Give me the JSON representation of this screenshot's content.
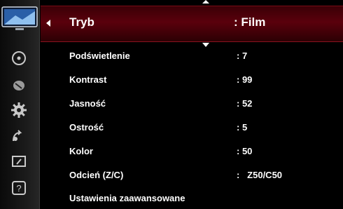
{
  "header": {
    "label": "Tryb",
    "value": ": Film"
  },
  "settings": [
    {
      "label": "Podświetlenie",
      "value": ": 7"
    },
    {
      "label": "Kontrast",
      "value": ": 99"
    },
    {
      "label": "Jasność",
      "value": ": 52"
    },
    {
      "label": "Ostrość",
      "value": ": 5"
    },
    {
      "label": "Kolor",
      "value": ": 50"
    },
    {
      "label": "Odcień (Z/C)",
      "value": ":   Z50/C50"
    },
    {
      "label": "Ustawienia zaawansowane",
      "value": ""
    }
  ],
  "sidebar": {
    "icons": [
      "tv-picture-icon",
      "disc-icon",
      "channel-icon",
      "gear-icon",
      "input-icon",
      "support-icon",
      "help-icon"
    ]
  },
  "colors": {
    "accent": "#5a000c",
    "background": "#000000"
  }
}
